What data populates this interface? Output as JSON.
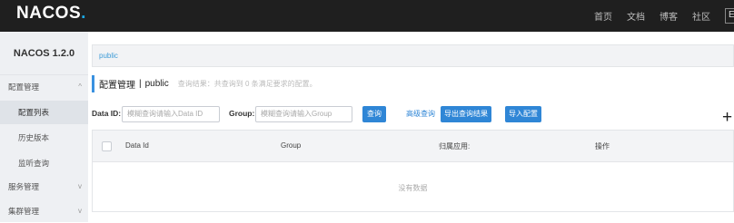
{
  "header": {
    "logo_main": "NACOS",
    "logo_dot": ".",
    "nav": [
      "首页",
      "文档",
      "博客",
      "社区"
    ],
    "lang": "En"
  },
  "sidebar": {
    "title": "NACOS 1.2.0",
    "items": [
      {
        "label": "配置管理",
        "type": "top",
        "chevron": "^"
      },
      {
        "label": "配置列表",
        "type": "sub",
        "active": true
      },
      {
        "label": "历史版本",
        "type": "sub"
      },
      {
        "label": "监听查询",
        "type": "sub"
      },
      {
        "label": "服务管理",
        "type": "top",
        "chevron": "v"
      },
      {
        "label": "集群管理",
        "type": "top",
        "chevron": "v"
      }
    ]
  },
  "namespace_bar": {
    "current": "public"
  },
  "page": {
    "title": "配置管理",
    "separator": "|",
    "namespace": "public",
    "hint": "查询结果：共查询到 0 条满足要求的配置。"
  },
  "filters": {
    "dataid_label": "Data ID:",
    "dataid_placeholder": "模糊查询请输入Data ID",
    "group_label": "Group:",
    "group_placeholder": "模糊查询请输入Group",
    "search_button": "查询",
    "advanced_link": "高级查询",
    "export_button": "导出查询结果",
    "import_button": "导入配置",
    "add_icon": "+"
  },
  "table": {
    "columns": [
      "Data Id",
      "Group",
      "归属应用:",
      "操作"
    ],
    "empty_text": "没有数据"
  }
}
